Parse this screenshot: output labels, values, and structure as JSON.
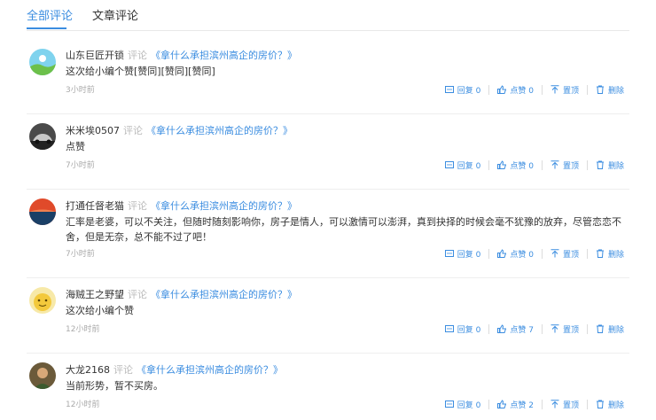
{
  "tabs": [
    {
      "label": "全部评论",
      "active": true
    },
    {
      "label": "文章评论",
      "active": false
    }
  ],
  "accent_color": "#3b8de0",
  "comments": [
    {
      "user": "山东巨匠开锁",
      "verb": "评论",
      "article": "《拿什么承担滨州高企的房价？》",
      "content": "这次给小编个赞[赞同][赞同][赞同]",
      "time": "3小时前",
      "reply": "回复 0",
      "like": "点赞 0",
      "top": "置顶",
      "delete": "删除",
      "avatar_icon": "landscape-avatar-icon"
    },
    {
      "user": "米米埃0507",
      "verb": "评论",
      "article": "《拿什么承担滨州高企的房价？》",
      "content": "点赞",
      "time": "7小时前",
      "reply": "回复 0",
      "like": "点赞 0",
      "top": "置顶",
      "delete": "删除",
      "avatar_icon": "car-avatar-icon"
    },
    {
      "user": "打通任督老猫",
      "verb": "评论",
      "article": "《拿什么承担滨州高企的房价？》",
      "content": "汇率是老婆，可以不关注，但随时随刻影响你，房子是情人，可以激情可以澎湃，真到抉择的时候会毫不犹豫的放弃，尽管恋恋不舍，但是无奈，总不能不过了吧！",
      "time": "7小时前",
      "reply": "回复 0",
      "like": "点赞 0",
      "top": "置顶",
      "delete": "删除",
      "avatar_icon": "sunset-avatar-icon"
    },
    {
      "user": "海贼王之野望",
      "verb": "评论",
      "article": "《拿什么承担滨州高企的房价？》",
      "content": "这次给小编个赞",
      "time": "12小时前",
      "reply": "回复 0",
      "like": "点赞 7",
      "top": "置顶",
      "delete": "删除",
      "avatar_icon": "cartoon-avatar-icon"
    },
    {
      "user": "大龙2168",
      "verb": "评论",
      "article": "《拿什么承担滨州高企的房价？》",
      "content": "当前形势，暂不买房。",
      "time": "12小时前",
      "reply": "回复 0",
      "like": "点赞 2",
      "top": "置顶",
      "delete": "删除",
      "avatar_icon": "photo-avatar-icon"
    }
  ]
}
